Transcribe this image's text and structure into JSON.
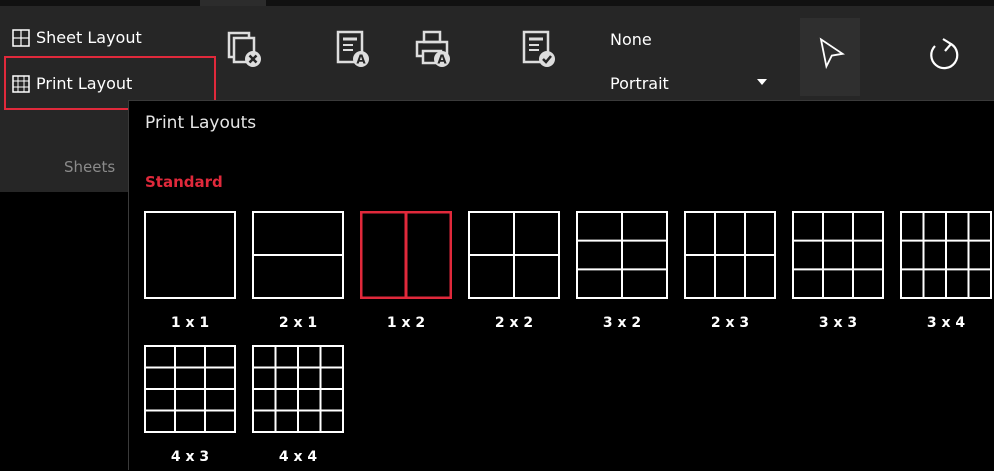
{
  "toolbar": {
    "sheet_layout_label": "Sheet Layout",
    "print_layout_label": "Print Layout",
    "group_label": "Sheets",
    "combo_top_value": "None",
    "combo_bottom_value": "Portrait",
    "highlight_color": "#e0293b"
  },
  "popup": {
    "title": "Print Layouts",
    "section_label": "Standard",
    "accent_color": "#e0293b",
    "layouts": [
      {
        "label": "1 x 1",
        "rows": 1,
        "cols": 1,
        "selected": false
      },
      {
        "label": "2 x 1",
        "rows": 2,
        "cols": 1,
        "selected": false
      },
      {
        "label": "1 x 2",
        "rows": 1,
        "cols": 2,
        "selected": true
      },
      {
        "label": "2 x 2",
        "rows": 2,
        "cols": 2,
        "selected": false
      },
      {
        "label": "3 x 2",
        "rows": 3,
        "cols": 2,
        "selected": false
      },
      {
        "label": "2 x 3",
        "rows": 2,
        "cols": 3,
        "selected": false
      },
      {
        "label": "3 x 3",
        "rows": 3,
        "cols": 3,
        "selected": false
      },
      {
        "label": "3 x 4",
        "rows": 3,
        "cols": 4,
        "selected": false
      },
      {
        "label": "4 x 3",
        "rows": 4,
        "cols": 3,
        "selected": false
      },
      {
        "label": "4 x 4",
        "rows": 4,
        "cols": 4,
        "selected": false
      }
    ]
  },
  "icons": [
    "sheet-layout-icon",
    "print-layout-icon",
    "remove-page-icon",
    "annotation-page-icon",
    "print-annotation-icon",
    "confirm-page-icon",
    "pointer-icon",
    "refresh-icon"
  ]
}
